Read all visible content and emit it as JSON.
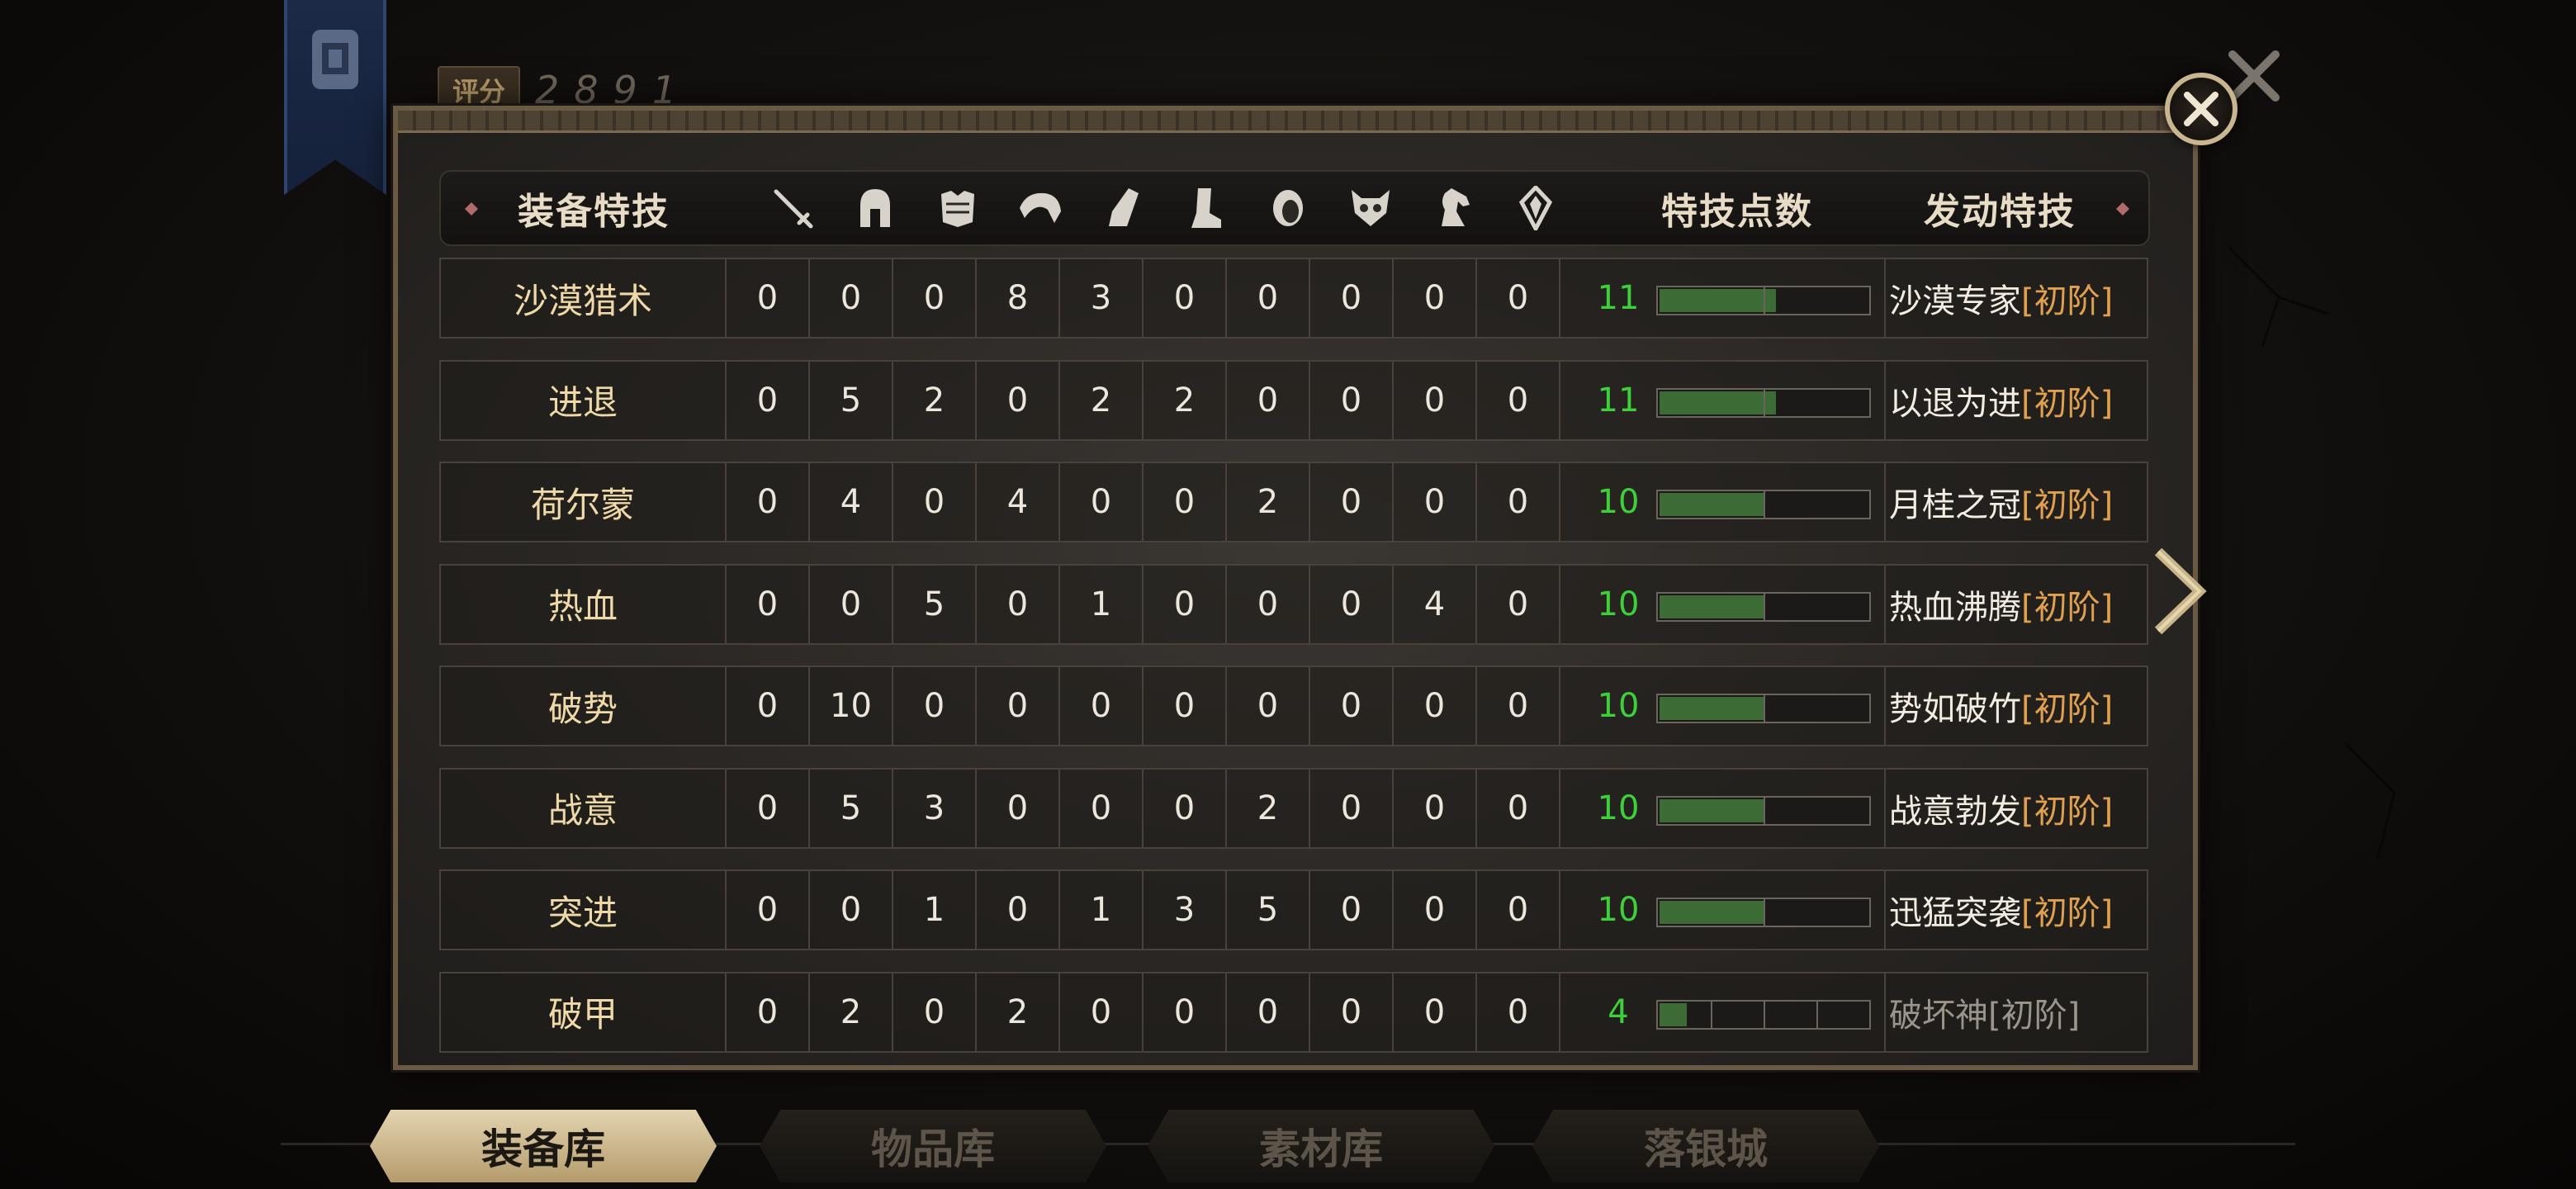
{
  "score": {
    "label": "评分",
    "value": "2891"
  },
  "header": {
    "skill": "装备特技",
    "slot_icons": [
      "sword-icon",
      "helmet-icon",
      "chest-armor-icon",
      "shoulder-icon",
      "gauntlet-icon",
      "boots-icon",
      "ring-icon",
      "mask-icon",
      "horse-icon",
      "gem-icon"
    ],
    "points": "特技点数",
    "activated": "发动特技"
  },
  "rows": [
    {
      "name": "沙漠猎术",
      "v": [
        0,
        0,
        0,
        8,
        3,
        0,
        0,
        0,
        0,
        0
      ],
      "points": "11",
      "fill": 0.55,
      "segments": 1,
      "active": "沙漠专家",
      "tier": "[初阶]",
      "dim": false
    },
    {
      "name": "进退",
      "v": [
        0,
        5,
        2,
        0,
        2,
        2,
        0,
        0,
        0,
        0
      ],
      "points": "11",
      "fill": 0.55,
      "segments": 1,
      "active": "以退为进",
      "tier": "[初阶]",
      "dim": false
    },
    {
      "name": "荷尔蒙",
      "v": [
        0,
        4,
        0,
        4,
        0,
        0,
        2,
        0,
        0,
        0
      ],
      "points": "10",
      "fill": 0.5,
      "segments": 1,
      "active": "月桂之冠",
      "tier": "[初阶]",
      "dim": false
    },
    {
      "name": "热血",
      "v": [
        0,
        0,
        5,
        0,
        1,
        0,
        0,
        0,
        4,
        0
      ],
      "points": "10",
      "fill": 0.5,
      "segments": 1,
      "active": "热血沸腾",
      "tier": "[初阶]",
      "dim": false
    },
    {
      "name": "破势",
      "v": [
        0,
        10,
        0,
        0,
        0,
        0,
        0,
        0,
        0,
        0
      ],
      "points": "10",
      "fill": 0.5,
      "segments": 1,
      "active": "势如破竹",
      "tier": "[初阶]",
      "dim": false
    },
    {
      "name": "战意",
      "v": [
        0,
        5,
        3,
        0,
        0,
        0,
        2,
        0,
        0,
        0
      ],
      "points": "10",
      "fill": 0.5,
      "segments": 1,
      "active": "战意勃发",
      "tier": "[初阶]",
      "dim": false
    },
    {
      "name": "突进",
      "v": [
        0,
        0,
        1,
        0,
        1,
        3,
        5,
        0,
        0,
        0
      ],
      "points": "10",
      "fill": 0.5,
      "segments": 1,
      "active": "迅猛突袭",
      "tier": "[初阶]",
      "dim": false
    },
    {
      "name": "破甲",
      "v": [
        0,
        2,
        0,
        2,
        0,
        0,
        0,
        0,
        0,
        0
      ],
      "points": "4",
      "fill": 0.13,
      "segments": 3,
      "active": "破坏神",
      "tier": "[初阶]",
      "dim": true
    }
  ],
  "tabs": [
    {
      "label": "装备库",
      "active": true
    },
    {
      "label": "物品库",
      "active": false
    },
    {
      "label": "素材库",
      "active": false
    },
    {
      "label": "落银城",
      "active": false
    }
  ],
  "colors": {
    "points_green": "#3ed03a",
    "tier_orange": "#e0a050",
    "skill_gold": "#f0d9a8"
  }
}
